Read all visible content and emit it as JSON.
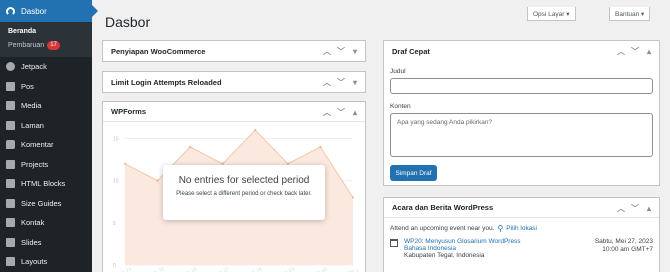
{
  "sidebar": {
    "top": {
      "label": "Dasbor",
      "icon": "gauge-icon"
    },
    "submenu": {
      "home": "Beranda",
      "updates": "Pembaruan",
      "updates_count": "17"
    },
    "items": [
      {
        "label": "Jetpack",
        "icon": "jetpack-icon"
      },
      {
        "label": "Pos",
        "icon": "pin-icon"
      },
      {
        "label": "Media",
        "icon": "media-icon"
      },
      {
        "label": "Laman",
        "icon": "page-icon"
      },
      {
        "label": "Komentar",
        "icon": "comment-icon"
      },
      {
        "label": "Projects",
        "icon": "projects-icon"
      },
      {
        "label": "HTML Blocks",
        "icon": "html-blocks-icon"
      },
      {
        "label": "Size Guides",
        "icon": "size-guides-icon"
      },
      {
        "label": "Kontak",
        "icon": "mail-icon"
      },
      {
        "label": "Slides",
        "icon": "slides-icon"
      },
      {
        "label": "Layouts",
        "icon": "layouts-icon"
      }
    ]
  },
  "header": {
    "title": "Dasbor",
    "screen_options": "Opsi Layar ▾",
    "help": "Bantuan ▾"
  },
  "widgets": {
    "woocommerce": {
      "title": "Penyiapan WooCommerce"
    },
    "limit_login": {
      "title": "Limit Login Attempts Reloaded"
    },
    "wpforms": {
      "title": "WPForms",
      "empty_title": "No entries for selected period",
      "empty_text": "Please select a different period or check back later."
    },
    "quick_draft": {
      "title": "Draf Cepat",
      "title_label": "Judul",
      "title_value": "",
      "content_label": "Konten",
      "content_placeholder": "Apa yang sedang Anda pikirkan?",
      "save_button": "Simpan Draf"
    },
    "events": {
      "title": "Acara dan Berita WordPress",
      "attend_text": "Attend an upcoming event near you.",
      "select_location": "Pilih lokasi",
      "event_title": "WP20: Menyusun Glosarium WordPress",
      "event_sub": "Bahasa Indonesia",
      "event_location": "Kabupaten Tegal, Indonesia",
      "event_date": "Sabtu, Mei 27, 2023",
      "event_time": "10:00 am GMT+7"
    }
  },
  "chart_data": {
    "type": "area",
    "x": [
      "Apr 24",
      "Apr 25",
      "Apr 26",
      "Apr 27",
      "Apr 28",
      "Apr 29",
      "Apr 30",
      "Mei 1"
    ],
    "values": [
      12,
      10,
      14,
      12,
      16,
      12,
      14,
      8
    ],
    "ylim": [
      0,
      16
    ],
    "yticks": [
      0,
      5,
      10,
      15
    ],
    "color": "#e27730"
  },
  "colors": {
    "accent": "#2271b1",
    "sidebar": "#1d2327",
    "badge": "#d63638",
    "chart_fill": "#fbe9e0"
  }
}
